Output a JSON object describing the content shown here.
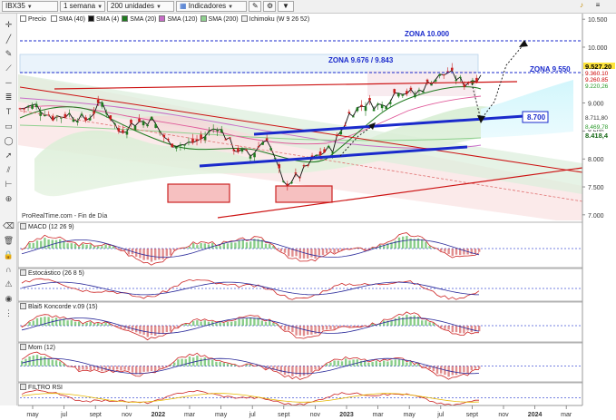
{
  "toolbar": {
    "symbol": "IBX35",
    "period": "1 semana",
    "units": "200 unidades",
    "indicators": "Indicadores"
  },
  "legend": {
    "price": "Precio",
    "items": [
      {
        "label": "SMA (40)",
        "color": "#ffffff"
      },
      {
        "label": "SMA (4)",
        "color": "#111111"
      },
      {
        "label": "SMA (20)",
        "color": "#1f7a1f"
      },
      {
        "label": "SMA (120)",
        "color": "#c86cc8"
      },
      {
        "label": "SMA (200)",
        "color": "#8ed08e"
      },
      {
        "label": "Ichimoku (W 9 26 52)",
        "color": "#eeeeee"
      }
    ],
    "watermark": "ProRealTime.com - Fin de Día"
  },
  "annotations": {
    "zona_10000": "ZONA 10.000",
    "zona_9676": "ZONA 9.676 / 9.843",
    "zona_9550": "ZONA 9.550",
    "level_8700": "8.700"
  },
  "right_axis": {
    "prices": [
      "10.500",
      "10.000",
      "9.500",
      "9.000",
      "8.500",
      "8.000",
      "7.500",
      "7.000"
    ],
    "badges": [
      {
        "text": "9.527,20",
        "bg": "#ffe53b",
        "fg": "#000000"
      },
      {
        "text": "9.360,10",
        "bg": "#ffffff",
        "fg": "#cc0000"
      },
      {
        "text": "9.260,85",
        "bg": "#ffffff",
        "fg": "#cc0000"
      },
      {
        "text": "9.220,26",
        "bg": "#ffffff",
        "fg": "#2a9a2a"
      },
      {
        "text": "8.711,80",
        "bg": "#ffffff",
        "fg": "#333333"
      },
      {
        "text": "8.469,78",
        "bg": "#ffffff",
        "fg": "#2a9a2a"
      },
      {
        "text": "8.418,4",
        "bg": "#ffffff",
        "fg": "#1a6a1a"
      }
    ],
    "macd": [
      "115,03",
      "119,81",
      "-25,624",
      "-200"
    ],
    "stoch": [
      "75,635",
      "72,643"
    ],
    "koncorde": [
      "83,595",
      "-29,657"
    ],
    "mom": [
      "-65,300"
    ],
    "rsi": [
      "60,671",
      "56,091"
    ]
  },
  "panels": {
    "macd": "MACD (12 26 9)",
    "stoch": "Estocástico (26 8 5)",
    "koncorde": "Blai5 Koncorde v.09 (15)",
    "mom": "Mom (12)",
    "rsi": "FILTRO RSI"
  },
  "x_axis": {
    "labels": [
      "may",
      "jul",
      "sept",
      "nov",
      "2022",
      "mar",
      "may",
      "jul",
      "sept",
      "nov",
      "2023",
      "mar",
      "may",
      "jul",
      "sept",
      "nov",
      "2024",
      "mar"
    ]
  },
  "colors": {
    "bull": "#1f7a1f",
    "bear": "#c81e1e",
    "trend_blue": "#1a2acc",
    "resistance_red": "#cc1111",
    "cloud_green": "#cfe9c8",
    "cloud_red": "#f2d2d2",
    "forecast_cyan": "#cdf3fb"
  },
  "chart_data": {
    "type": "line",
    "title": "IBX35",
    "xlabel": "",
    "ylabel": "",
    "ylim": [
      6900,
      10600
    ],
    "x": [
      "2021-05",
      "2021-06",
      "2021-07",
      "2021-08",
      "2021-09",
      "2021-10",
      "2021-11",
      "2021-12",
      "2022-01",
      "2022-02",
      "2022-03",
      "2022-04",
      "2022-05",
      "2022-06",
      "2022-07",
      "2022-08",
      "2022-09",
      "2022-10",
      "2022-11",
      "2022-12",
      "2023-01",
      "2023-02",
      "2023-03",
      "2023-04",
      "2023-05",
      "2023-06",
      "2023-07",
      "2023-08",
      "2023-09"
    ],
    "series": [
      {
        "name": "Precio",
        "values": [
          8900,
          8950,
          8750,
          8800,
          8700,
          9000,
          8500,
          8650,
          8700,
          8300,
          8250,
          8350,
          8600,
          8200,
          8050,
          8400,
          7550,
          7700,
          8050,
          8200,
          8800,
          9000,
          8950,
          9250,
          9150,
          9400,
          9550,
          9350,
          9500
        ]
      }
    ],
    "levels": [
      10000,
      9843,
      9676,
      9550,
      8700
    ]
  }
}
